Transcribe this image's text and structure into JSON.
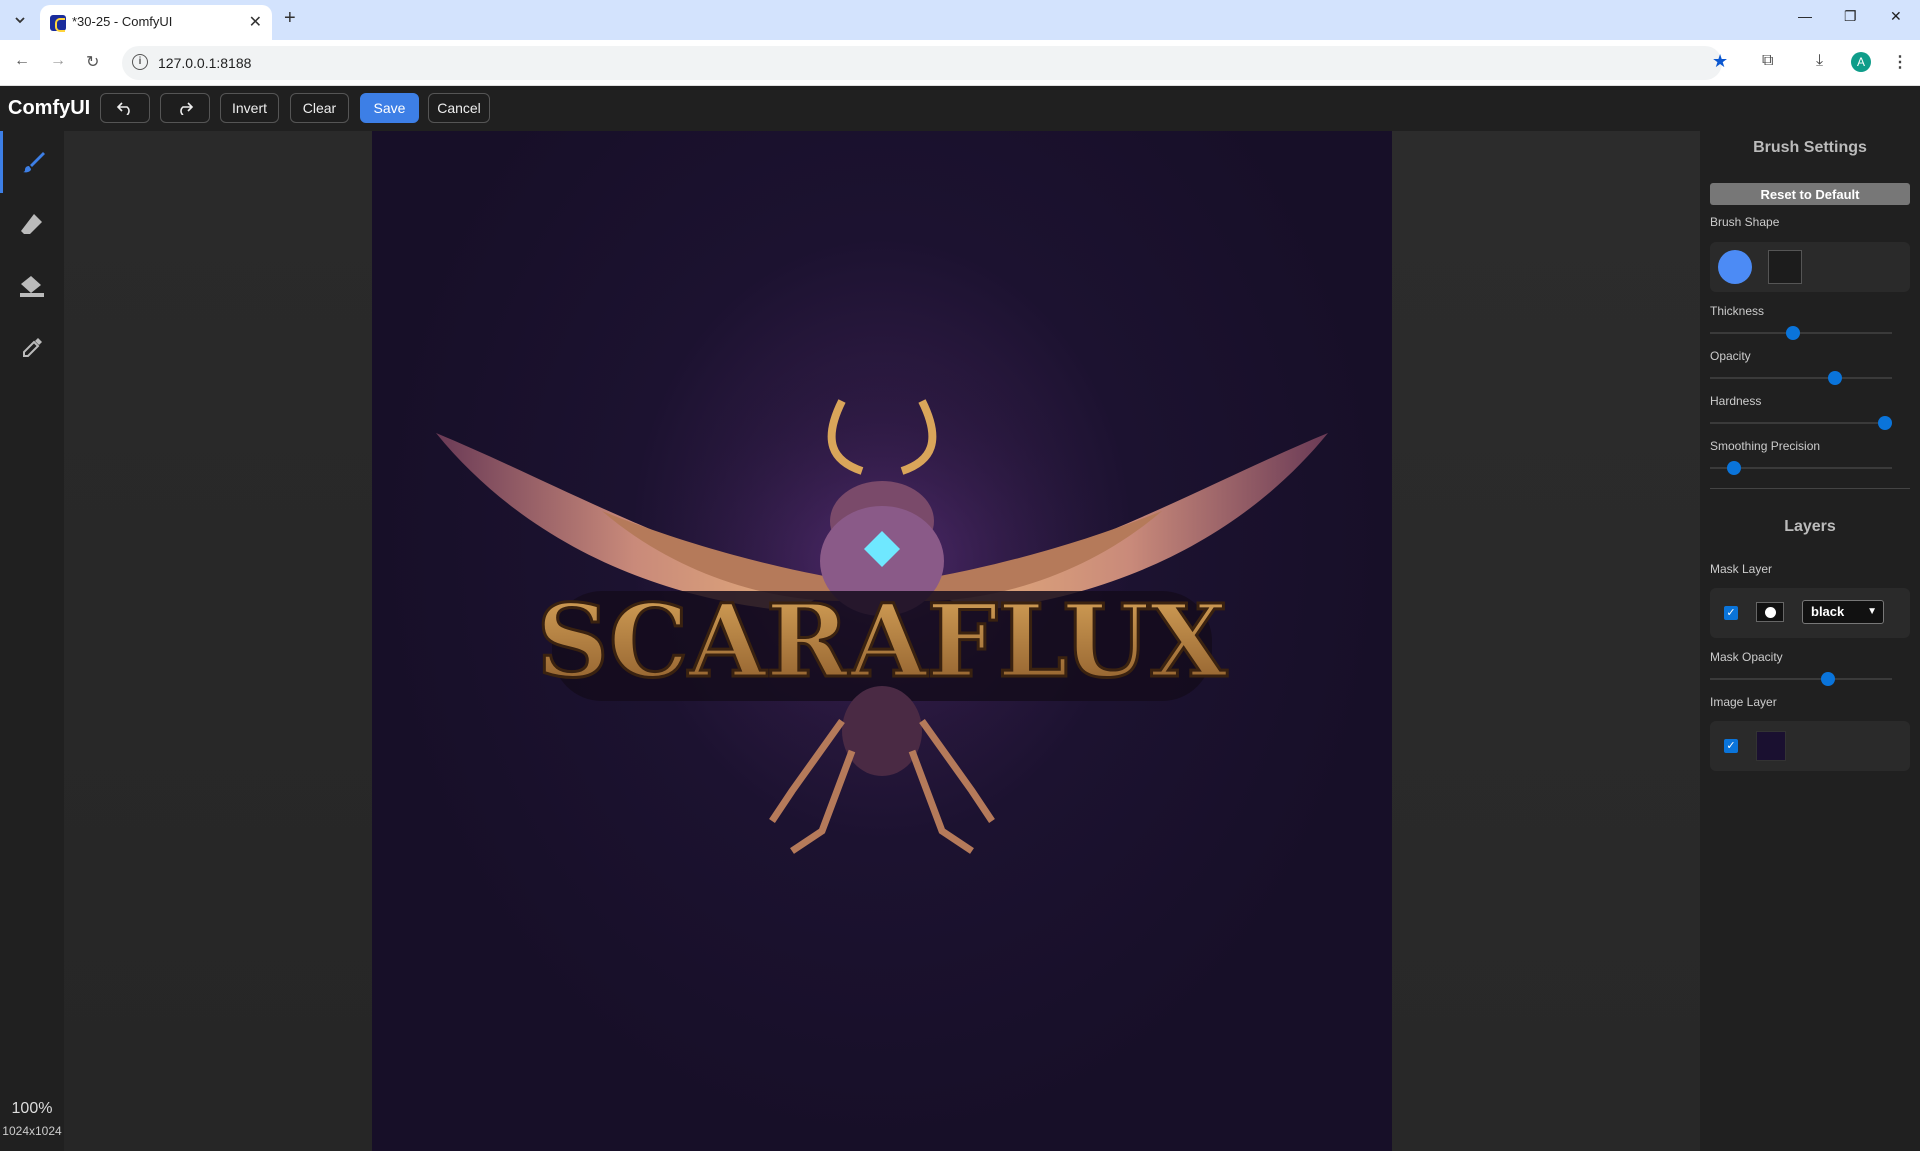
{
  "browser": {
    "tab_title": "*30-25 - ComfyUI",
    "url": "127.0.0.1:8188",
    "avatar_letter": "A"
  },
  "toolbar": {
    "brand": "ComfyUI",
    "invert_label": "Invert",
    "clear_label": "Clear",
    "save_label": "Save",
    "cancel_label": "Cancel"
  },
  "canvas": {
    "zoom": "100%",
    "dimensions": "1024x1024",
    "image_text": "SCARAFLUX"
  },
  "brush_settings": {
    "title": "Brush Settings",
    "reset_label": "Reset to Default",
    "shape_label": "Brush Shape",
    "selected_shape": "circle",
    "sliders": [
      {
        "label": "Thickness",
        "value": 0.45
      },
      {
        "label": "Opacity",
        "value": 0.7
      },
      {
        "label": "Hardness",
        "value": 1.0
      },
      {
        "label": "Smoothing Precision",
        "value": 0.1
      }
    ]
  },
  "layers": {
    "title": "Layers",
    "mask_layer_label": "Mask Layer",
    "mask_layer_visible": true,
    "mask_color": "black",
    "mask_opacity_label": "Mask Opacity",
    "mask_opacity_value": 0.66,
    "image_layer_label": "Image Layer",
    "image_layer_visible": true
  },
  "colors": {
    "accent": "#3d7fe6",
    "slider_knob": "#0a74da"
  }
}
